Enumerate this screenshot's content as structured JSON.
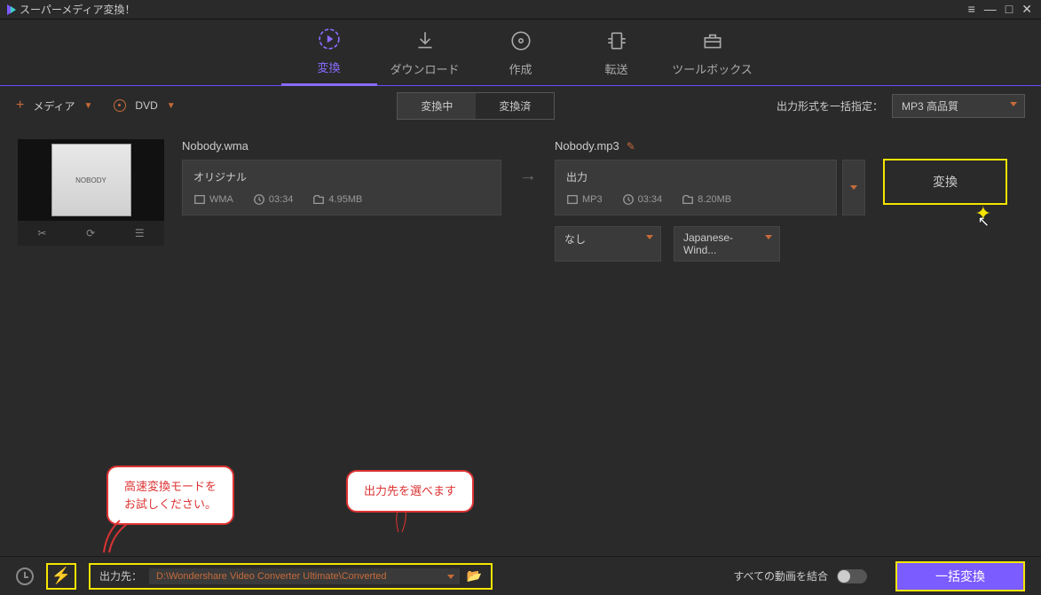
{
  "app": {
    "title": "スーパーメディア変換！"
  },
  "tabs": {
    "convert": "変換",
    "download": "ダウンロード",
    "create": "作成",
    "transfer": "転送",
    "toolbox": "ツールボックス"
  },
  "toolbar": {
    "add_media": "メディア",
    "dvd": "DVD",
    "seg_converting": "変換中",
    "seg_converted": "変換済",
    "format_label": "出力形式を一括指定：",
    "format_value": "MP3 高品質"
  },
  "file": {
    "src_name": "Nobody.wma",
    "src_title": "オリジナル",
    "src_format": "WMA",
    "src_duration": "03:34",
    "src_size": "4.95MB",
    "out_name": "Nobody.mp3",
    "out_title": "出力",
    "out_format": "MP3",
    "out_duration": "03:34",
    "out_size": "8.20MB",
    "convert_btn": "変換",
    "sub_none": "なし",
    "sub_lang": "Japanese-Wind..."
  },
  "callouts": {
    "c1_line1": "高速変換モードを",
    "c1_line2": "お試しください。",
    "c2": "出力先を選べます"
  },
  "bottom": {
    "path_label": "出力先：",
    "path_value": "D:\\Wondershare Video Converter Ultimate\\Converted",
    "merge_label": "すべての動画を結合",
    "batch_btn": "一括変換"
  }
}
